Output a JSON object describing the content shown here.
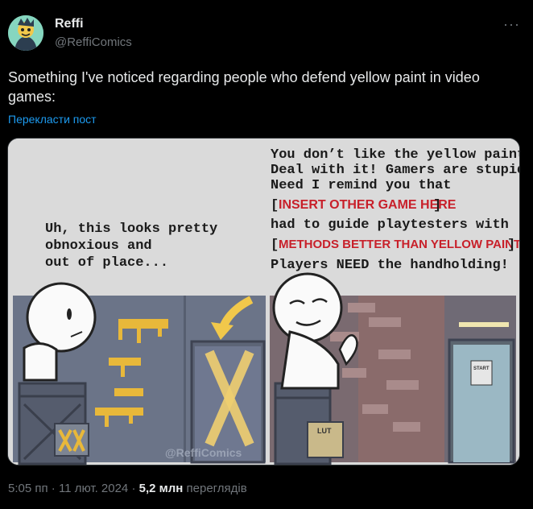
{
  "author": {
    "name": "Reffi",
    "handle": "@ReffiComics"
  },
  "tweet": {
    "text": "Something I've noticed regarding people who defend yellow paint in video games:",
    "translate_label": "Перекласти пост"
  },
  "comic": {
    "left_speech": [
      "Uh, this looks pretty",
      "obnoxious and",
      "out of place..."
    ],
    "right_speech": {
      "line1": "You don’t like the yellow paint?",
      "line2": "Deal with it! Gamers are stupid!",
      "line3": "Need I remind you that",
      "bracket1": "INSERT OTHER GAME HERE",
      "line4": "had to guide playtesters with",
      "bracket2": "METHODS BETTER THAN YELLOW PAINT",
      "line5": "Players NEED the handholding!"
    },
    "watermark": "@ReffiComics",
    "loot_label": "LUT",
    "exit_sign": "START"
  },
  "meta": {
    "time": "5:05 пп",
    "date": "11 лют. 2024",
    "views_count": "5,2 млн",
    "views_label": "переглядів",
    "separator": "·"
  },
  "colors": {
    "accent_link": "#1d9bf0",
    "background": "#000000",
    "text_primary": "#e7e9ea",
    "text_secondary": "#71767b",
    "comic_red": "#c8202a",
    "paint_yellow": "#e8b83a"
  },
  "icons": {
    "more": "more-horizontal-icon",
    "avatar": "avatar-image"
  }
}
